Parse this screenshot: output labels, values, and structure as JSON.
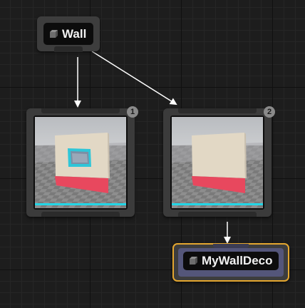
{
  "graph": {
    "nodes": [
      {
        "id": "wall",
        "label": "Wall",
        "icon": "cube-icon"
      },
      {
        "id": "variation-1",
        "badge": "1",
        "preview": "wall-with-decal-preview"
      },
      {
        "id": "variation-2",
        "badge": "2",
        "preview": "plain-wall-preview"
      },
      {
        "id": "mywalldeco",
        "label": "MyWallDeco",
        "icon": "cube-icon",
        "selected": true
      }
    ],
    "connections": [
      {
        "from": "wall",
        "to": "variation-1"
      },
      {
        "from": "wall",
        "to": "variation-2"
      },
      {
        "from": "variation-2",
        "to": "mywalldeco"
      }
    ]
  },
  "colors": {
    "background": "#1d1d1d",
    "node": "#3b3b3b",
    "selection_outline": "#e3a62f",
    "decorator_fill": "#54567a",
    "preview_bar": "#23d6e6",
    "wall_face": "#e2d8c5",
    "wall_base": "#e8485e"
  }
}
